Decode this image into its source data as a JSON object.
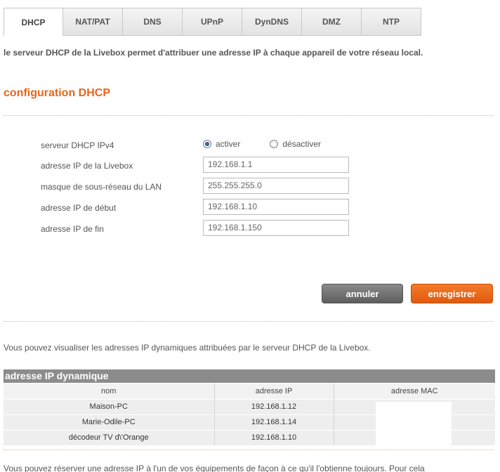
{
  "tabs": [
    {
      "label": "DHCP"
    },
    {
      "label": "NAT/PAT"
    },
    {
      "label": "DNS"
    },
    {
      "label": "UPnP"
    },
    {
      "label": "DynDNS"
    },
    {
      "label": "DMZ"
    },
    {
      "label": "NTP"
    }
  ],
  "intro": "le serveur DHCP de la Livebox permet d'attribuer une adresse IP à chaque appareil de votre réseau local.",
  "section_title": "configuration DHCP",
  "form": {
    "dhcp_label": "serveur DHCP IPv4",
    "activate_label": "activer",
    "deactivate_label": "désactiver",
    "ip_label": "adresse IP de la Livebox",
    "ip_value": "192.168.1.1",
    "mask_label": "masque de sous-réseau du LAN",
    "mask_value": "255.255.255.0",
    "start_label": "adresse IP de début",
    "start_value": "192.168.1.10",
    "end_label": "adresse IP de fin",
    "end_value": "192.168.1.150"
  },
  "buttons": {
    "cancel": "annuler",
    "save": "enregistrer"
  },
  "visual_text": "Vous pouvez visualiser les adresses IP dynamiques attribuées par le serveur DHCP de la Livebox.",
  "table": {
    "title": "adresse IP dynamique",
    "headers": [
      "nom",
      "adresse IP",
      "adresse MAC"
    ],
    "rows": [
      {
        "name": "Maison-PC",
        "ip": "192.168.1.12",
        "mac": ""
      },
      {
        "name": "Marie-Odile-PC",
        "ip": "192.168.1.14",
        "mac": ""
      },
      {
        "name": "décodeur TV d\\'Orange",
        "ip": "192.168.1.10",
        "mac": ""
      }
    ]
  },
  "bottom_text": "Vous pouvez réserver une adresse IP à l'un de vos équipements de façon à ce qu'il l'obtienne toujours. Pour cela"
}
